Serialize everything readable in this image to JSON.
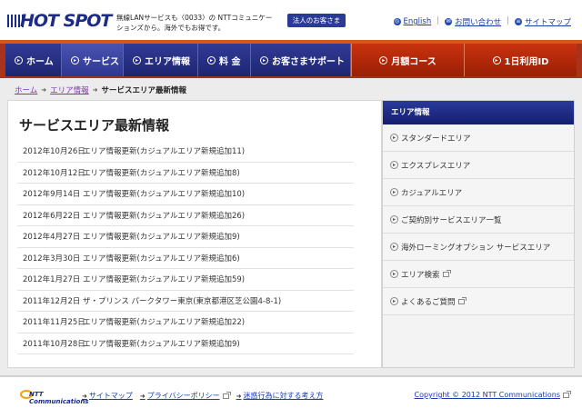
{
  "header": {
    "logo_text": "HOT SPOT",
    "tagline": "無線LANサービスも〈0033〉の NTTコミュニケーションズから。海外でもお得です。",
    "corporate_button": "法人のお客さま",
    "links": [
      {
        "label": "English",
        "icon": "globe-icon"
      },
      {
        "label": "お問い合わせ",
        "icon": "mail-icon"
      },
      {
        "label": "サイトマップ",
        "icon": "sitemap-icon"
      }
    ]
  },
  "nav": {
    "items": [
      {
        "label": "ホーム"
      },
      {
        "label": "サービス"
      },
      {
        "label": "エリア情報"
      },
      {
        "label": "料 金"
      },
      {
        "label": "お客さまサポート"
      }
    ],
    "red_items": [
      {
        "label": "月額コース"
      },
      {
        "label": "1日利用ID"
      }
    ]
  },
  "breadcrumb": {
    "home": "ホーム",
    "area": "エリア情報",
    "current": "サービスエリア最新情報"
  },
  "main": {
    "title": "サービスエリア最新情報",
    "news": [
      {
        "date": "2012年10月26日",
        "title": "エリア情報更新(カジュアルエリア新規追加11)"
      },
      {
        "date": "2012年10月12日",
        "title": "エリア情報更新(カジュアルエリア新規追加8)"
      },
      {
        "date": "2012年9月14日",
        "title": "エリア情報更新(カジュアルエリア新規追加10)"
      },
      {
        "date": "2012年6月22日",
        "title": "エリア情報更新(カジュアルエリア新規追加26)"
      },
      {
        "date": "2012年4月27日",
        "title": "エリア情報更新(カジュアルエリア新規追加9)"
      },
      {
        "date": "2012年3月30日",
        "title": "エリア情報更新(カジュアルエリア新規追加6)"
      },
      {
        "date": "2012年1月27日",
        "title": "エリア情報更新(カジュアルエリア新規追加59)"
      },
      {
        "date": "2011年12月2日",
        "title": "ザ・プリンス パークタワー東京(東京都港区芝公園4-8-1)"
      },
      {
        "date": "2011年11月25日",
        "title": "エリア情報更新(カジュアルエリア新規追加22)"
      },
      {
        "date": "2011年10月28日",
        "title": "エリア情報更新(カジュアルエリア新規追加9)"
      }
    ]
  },
  "sidebar": {
    "heading": "エリア情報",
    "items": [
      {
        "label": "スタンダードエリア"
      },
      {
        "label": "エクスプレスエリア"
      },
      {
        "label": "カジュアルエリア"
      },
      {
        "label": "ご契約別サービスエリア一覧"
      },
      {
        "label": "海外ローミングオプション サービスエリア"
      },
      {
        "label": "エリア検索"
      },
      {
        "label": "よくあるご質問"
      }
    ]
  },
  "footer": {
    "logo_text": "NTT Communications",
    "links": [
      {
        "label": "サイトマップ"
      },
      {
        "label": "プライバシーポリシー"
      },
      {
        "label": "迷惑行為に対する考え方"
      }
    ],
    "copyright": "Copyright © 2012 NTT Communications"
  },
  "colors": {
    "brand_blue": "#1c2b86",
    "nav_red": "#a8331a",
    "link_blue": "#1a3aa8"
  }
}
